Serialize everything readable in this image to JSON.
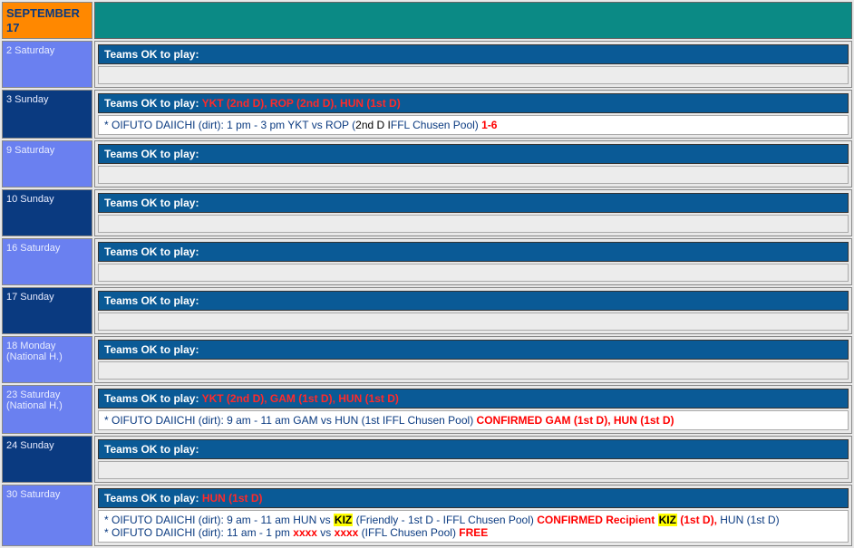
{
  "month_header": "SEPTEMBER 17",
  "rows": [
    {
      "date_class": "date-blue",
      "date_label": "2 Saturday",
      "bar": [
        {
          "t": "Teams OK to play:",
          "cls": ""
        }
      ],
      "body": null
    },
    {
      "date_class": "date-dark",
      "date_label": "3 Sunday",
      "bar": [
        {
          "t": "Teams OK to play: ",
          "cls": ""
        },
        {
          "t": "YKT (2nd D), ROP (2nd D), HUN (1st D)",
          "cls": "red"
        }
      ],
      "body": [
        {
          "t": "* OIFUTO DAIICHI (dirt): 1 pm - 3 pm YKT vs ROP (",
          "cls": "blue-txt"
        },
        {
          "t": "2nd D I",
          "cls": "black-txt"
        },
        {
          "t": "FFL Chusen Pool) ",
          "cls": "blue-txt"
        },
        {
          "t": "1-6",
          "cls": "red-txt"
        }
      ]
    },
    {
      "date_class": "date-blue",
      "date_label": "9 Saturday",
      "bar": [
        {
          "t": "Teams OK to play:",
          "cls": ""
        }
      ],
      "body": null
    },
    {
      "date_class": "date-dark",
      "date_label": "10 Sunday",
      "bar": [
        {
          "t": "Teams OK to play:",
          "cls": ""
        }
      ],
      "body": null
    },
    {
      "date_class": "date-blue",
      "date_label": "16 Saturday",
      "bar": [
        {
          "t": "Teams OK to play:",
          "cls": ""
        }
      ],
      "body": null
    },
    {
      "date_class": "date-dark",
      "date_label": "17 Sunday",
      "bar": [
        {
          "t": "Teams OK to play:",
          "cls": ""
        }
      ],
      "body": null
    },
    {
      "date_class": "date-blue",
      "date_label": "18 Monday (National H.)",
      "bar": [
        {
          "t": "Teams OK to play:",
          "cls": ""
        }
      ],
      "body": null
    },
    {
      "date_class": "date-blue",
      "date_label": "23 Saturday (National H.)",
      "bar": [
        {
          "t": "Teams OK to play: ",
          "cls": ""
        },
        {
          "t": "YKT (2nd D), GAM (1st D), HUN (1st D)",
          "cls": "red"
        }
      ],
      "body": [
        {
          "t": "* OIFUTO DAIICHI (dirt): 9 am - 11 am GAM vs HUN (1st IFFL Chusen Pool) ",
          "cls": "blue-txt"
        },
        {
          "t": "CONFIRMED GAM (1st D), HUN (1st D)",
          "cls": "red-txt"
        }
      ]
    },
    {
      "date_class": "date-dark",
      "date_label": "24 Sunday",
      "bar": [
        {
          "t": "Teams OK to play:",
          "cls": ""
        }
      ],
      "body": null
    },
    {
      "date_class": "date-blue",
      "date_label": "30 Saturday",
      "bar": [
        {
          "t": "Teams OK to play: ",
          "cls": ""
        },
        {
          "t": "HUN (1st D)",
          "cls": "red"
        }
      ],
      "body": [
        {
          "t": "* OIFUTO DAIICHI (dirt): 9 am - 11 am HUN vs ",
          "cls": "blue-txt"
        },
        {
          "t": "KIZ",
          "cls": "hl"
        },
        {
          "t": " (Friendly - 1st D - IFFL Chusen Pool) ",
          "cls": "blue-txt"
        },
        {
          "t": "CONFIRMED Recipient ",
          "cls": "red-txt"
        },
        {
          "t": "KIZ",
          "cls": "hl"
        },
        {
          "t": " (1st D), ",
          "cls": "red-txt"
        },
        {
          "t": "HUN (1st D)",
          "cls": "blue-txt"
        },
        {
          "t": "\n",
          "cls": ""
        },
        {
          "t": "* OIFUTO DAIICHI (dirt): 11 am - 1 pm ",
          "cls": "blue-txt"
        },
        {
          "t": "xxxx",
          "cls": "red-txt"
        },
        {
          "t": " vs ",
          "cls": "blue-txt"
        },
        {
          "t": "xxxx",
          "cls": "red-txt"
        },
        {
          "t": " (IFFL Chusen Pool) ",
          "cls": "blue-txt"
        },
        {
          "t": "FREE",
          "cls": "red-txt"
        }
      ]
    }
  ]
}
